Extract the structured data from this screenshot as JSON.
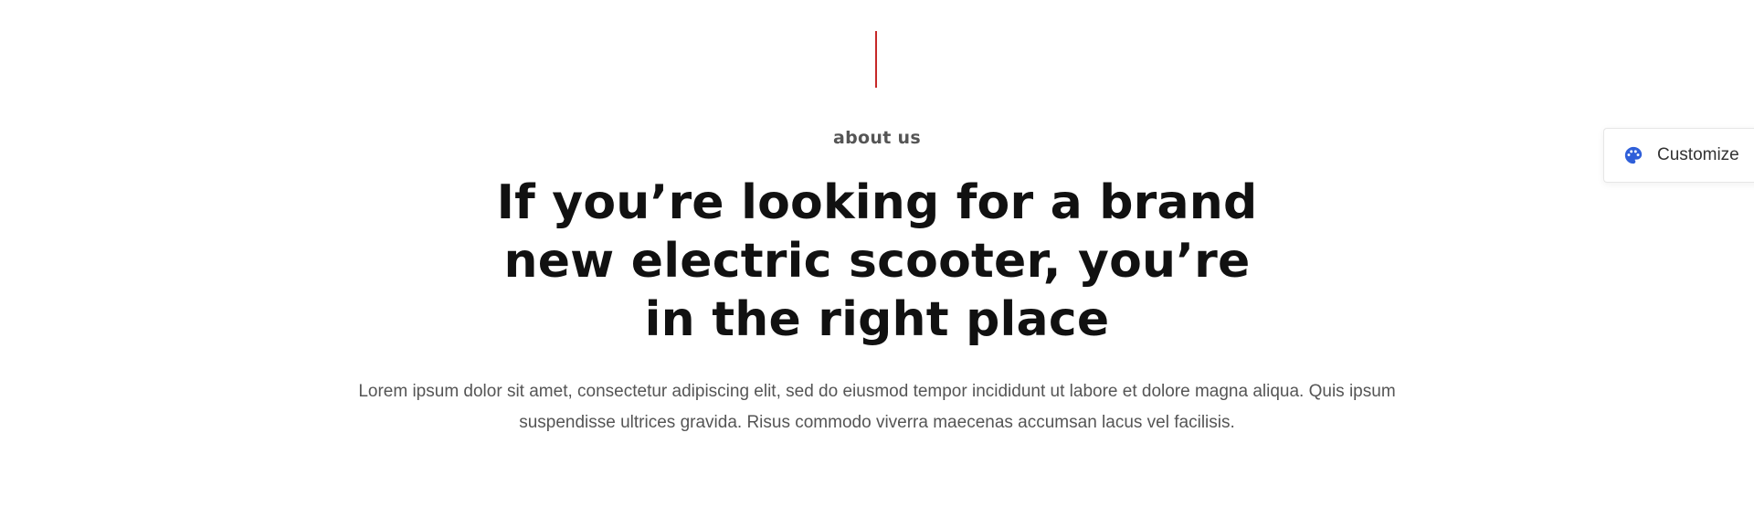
{
  "section": {
    "eyebrow": "about us",
    "headline": "If you’re looking for a brand new electric scooter, you’re in the right place",
    "body": "Lorem ipsum dolor sit amet, consectetur adipiscing elit, sed do eiusmod tempor incididunt ut labore et dolore magna aliqua. Quis ipsum suspendisse ultrices gravida. Risus commodo viverra maecenas accumsan lacus vel facilisis."
  },
  "customize": {
    "label": "Customize",
    "icon": "palette-icon"
  },
  "colors": {
    "accent_line": "#c62828",
    "palette_icon": "#2f5fd9",
    "headline": "#111111",
    "body_text": "#555555"
  }
}
